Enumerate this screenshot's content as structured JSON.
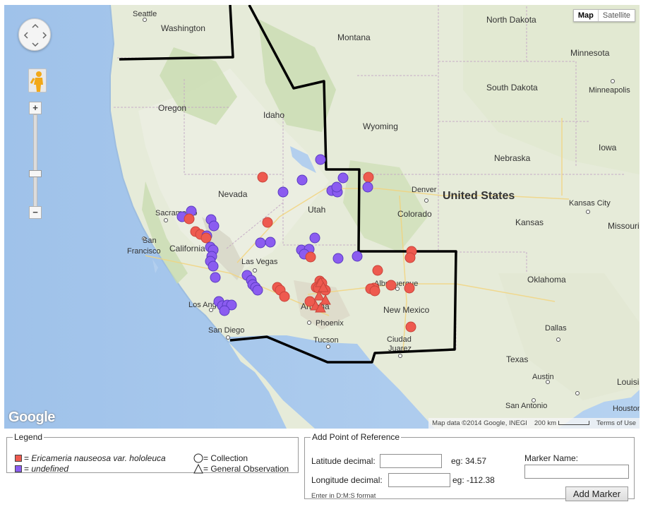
{
  "map": {
    "map_types": [
      "Map",
      "Satellite"
    ],
    "active_map_type": "Map",
    "attribution": "Map data ©2014 Google, INEGI",
    "scale_label": "200 km",
    "terms": "Terms of Use",
    "logo_text": "Google",
    "country_label": "United States",
    "state_labels": [
      "Washington",
      "Montana",
      "North Dakota",
      "Minnesota",
      "South Dakota",
      "Oregon",
      "Idaho",
      "Wyoming",
      "Nebraska",
      "Iowa",
      "Nevada",
      "Utah",
      "Colorado",
      "Kansas",
      "California",
      "Missouri",
      "Oklahoma",
      "New Mexico",
      "Arizona",
      "Texas",
      "Louisiana"
    ],
    "city_labels": [
      "Seattle",
      "Minneapolis",
      "Sacramento",
      "San Francisco",
      "Denver",
      "Kansas City",
      "Las Vegas",
      "Los Angeles",
      "San Diego",
      "Phoenix",
      "Albuquerque",
      "Tucson",
      "Ciudad Juarez",
      "Dallas",
      "Austin",
      "San Antonio",
      "Houston"
    ],
    "marker_colors": {
      "species": "#ee5a4f",
      "undefined": "#8b5cf0"
    }
  },
  "legend": {
    "title": "Legend",
    "species_prefix": "=",
    "species_name": "Ericameria nauseosa var. hololeuca",
    "undefined_prefix": "=",
    "undefined_name": "undefined",
    "collection": "= Collection",
    "general_observation": "= General Observation"
  },
  "reference": {
    "title": "Add Point of Reference",
    "lat_label": "Latitude decimal:",
    "lat_eg": "eg: 34.57",
    "lat_value": "",
    "lon_label": "Longitude decimal:",
    "lon_eg": "eg: -112.38",
    "lon_value": "",
    "dms_link": "Enter in D:M:S format",
    "marker_name_label": "Marker Name:",
    "marker_name_value": "",
    "add_button": "Add Marker"
  }
}
